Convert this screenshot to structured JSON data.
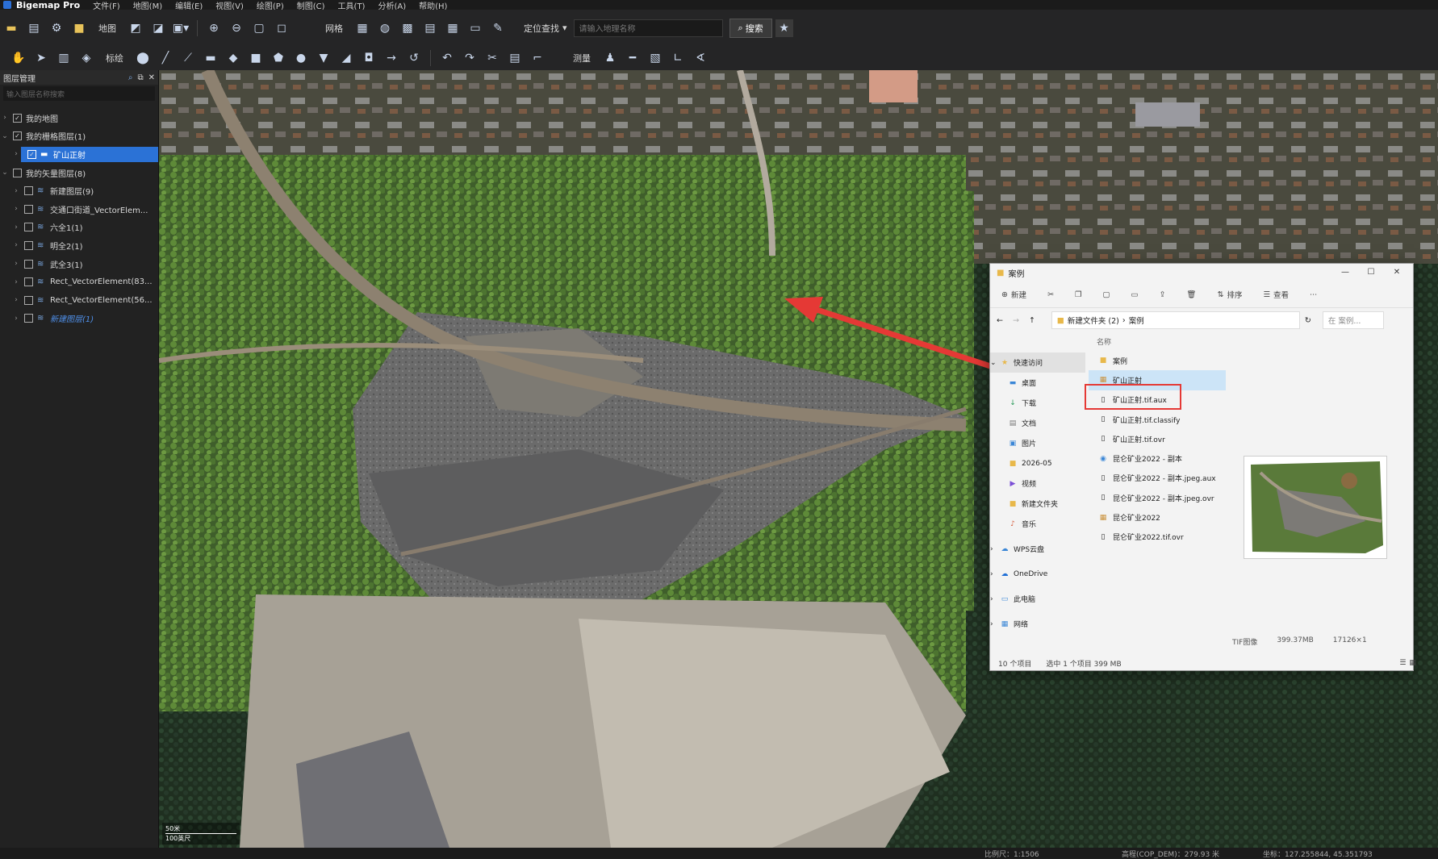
{
  "app": {
    "title": "Bigemap Pro"
  },
  "menu": [
    "文件(F)",
    "地图(M)",
    "编辑(E)",
    "视图(V)",
    "绘图(P)",
    "制图(C)",
    "工具(T)",
    "分析(A)",
    "帮助(H)"
  ],
  "toolbar": {
    "map_label": "地图",
    "grid_label": "网格",
    "locate_label": "定位查找",
    "search_placeholder": "请输入地理名称",
    "search_button": "搜索",
    "annotate_label": "标绘",
    "measure_label": "测量"
  },
  "layers_panel": {
    "title": "图层管理",
    "search_placeholder": "输入图层名称搜索",
    "items": [
      {
        "label": "我的地图",
        "level": 0,
        "checked": true
      },
      {
        "label": "我的栅格图层(1)",
        "level": 0,
        "checked": true,
        "expanded": true
      },
      {
        "label": "矿山正射",
        "level": 1,
        "checked": true,
        "selected": true
      },
      {
        "label": "我的矢量图层(8)",
        "level": 0,
        "checked": false,
        "expanded": true
      },
      {
        "label": "新建图层(9)",
        "level": 1,
        "checked": false
      },
      {
        "label": "交通口街道_VectorElem...",
        "level": 1,
        "checked": false
      },
      {
        "label": "六全1(1)",
        "level": 1,
        "checked": false
      },
      {
        "label": "明全2(1)",
        "level": 1,
        "checked": false
      },
      {
        "label": "武全3(1)",
        "level": 1,
        "checked": false
      },
      {
        "label": "Rect_VectorElement(83...",
        "level": 1,
        "checked": false
      },
      {
        "label": "Rect_VectorElement(56...",
        "level": 1,
        "checked": false
      },
      {
        "label": "新建图层(1)",
        "level": 1,
        "checked": false,
        "highlight": true
      }
    ]
  },
  "scale": {
    "top": "50米",
    "bottom": "100英尺"
  },
  "explorer": {
    "title": "案例",
    "cmd_new": "新建",
    "cmd_sort": "排序",
    "cmd_view": "查看",
    "path": [
      "新建文件夹 (2)",
      "案例"
    ],
    "search_placeholder": "在 案例...",
    "column_name": "名称",
    "nav": [
      {
        "label": "快速访问",
        "icon": "star",
        "selected": true
      },
      {
        "label": "桌面",
        "icon": "desktop"
      },
      {
        "label": "下载",
        "icon": "download"
      },
      {
        "label": "文档",
        "icon": "doc"
      },
      {
        "label": "图片",
        "icon": "picture"
      },
      {
        "label": "2026-05",
        "icon": "folder"
      },
      {
        "label": "视频",
        "icon": "video"
      },
      {
        "label": "新建文件夹",
        "icon": "folder"
      },
      {
        "label": "音乐",
        "icon": "music"
      },
      {
        "label": "WPS云盘",
        "icon": "cloud"
      },
      {
        "label": "OneDrive",
        "icon": "cloud"
      },
      {
        "label": "此电脑",
        "icon": "pc"
      },
      {
        "label": "网络",
        "icon": "network"
      }
    ],
    "files": [
      {
        "label": "案例",
        "icon": "folder"
      },
      {
        "label": "矿山正射",
        "icon": "image",
        "selected": true
      },
      {
        "label": "矿山正射.tif.aux",
        "icon": "file"
      },
      {
        "label": "矿山正射.tif.classify",
        "icon": "file"
      },
      {
        "label": "矿山正射.tif.ovr",
        "icon": "file"
      },
      {
        "label": "昆仑矿业2022 - 副本",
        "icon": "image"
      },
      {
        "label": "昆仑矿业2022 - 副本.jpeg.aux",
        "icon": "file"
      },
      {
        "label": "昆仑矿业2022 - 副本.jpeg.ovr",
        "icon": "file"
      },
      {
        "label": "昆仑矿业2022",
        "icon": "image"
      },
      {
        "label": "昆仑矿业2022.tif.ovr",
        "icon": "file"
      }
    ],
    "details": {
      "type": "TIF图像",
      "size": "399.37MB",
      "dims": "17126×1"
    },
    "status": {
      "count": "10 个项目",
      "selection": "选中 1 个项目 399 MB"
    }
  },
  "status_bar": {
    "scale": "比例尺：1:1506",
    "elevation": "高程(COP_DEM)：279.93 米",
    "coords": "坐标：127.255844, 45.351793"
  },
  "colors": {
    "accent": "#2b72d6",
    "arrow": "#e53935"
  }
}
